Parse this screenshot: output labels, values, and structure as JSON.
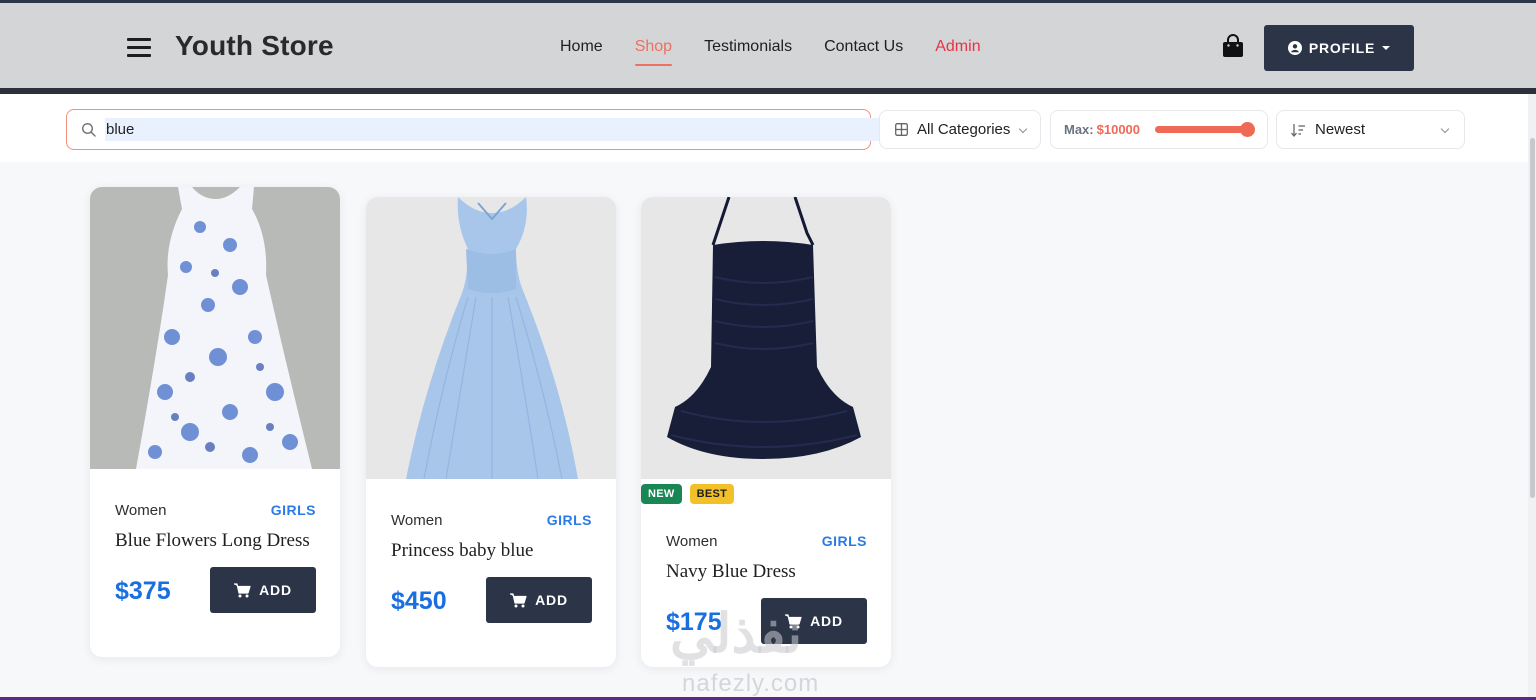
{
  "brand": "Youth Store",
  "nav": {
    "home": "Home",
    "shop": "Shop",
    "testimonials": "Testimonials",
    "contact": "Contact Us",
    "admin": "Admin"
  },
  "profile_label": "PROFILE",
  "search": {
    "value": "blue"
  },
  "filters": {
    "category": "All Categories",
    "max_label": "Max:",
    "max_value": "$10000",
    "max_slider_fraction": 1.0,
    "sort": "Newest"
  },
  "products": [
    {
      "category": "Women",
      "subcategory": "GIRLS",
      "title": "Blue Flowers Long Dress",
      "price": "$375",
      "add_label": "ADD",
      "badges": []
    },
    {
      "category": "Women",
      "subcategory": "GIRLS",
      "title": "Princess baby blue",
      "price": "$450",
      "add_label": "ADD",
      "badges": []
    },
    {
      "category": "Women",
      "subcategory": "GIRLS",
      "title": "Navy Blue Dress",
      "price": "$175",
      "add_label": "ADD",
      "badges": [
        "NEW",
        "BEST"
      ]
    }
  ],
  "watermark": {
    "arabic": "نفذلي",
    "latin": "nafezly.com"
  },
  "colors": {
    "accent": "#ee6a57",
    "dark_button": "#2b3547",
    "price_blue": "#1a6fe0",
    "admin_red": "#e53448"
  }
}
